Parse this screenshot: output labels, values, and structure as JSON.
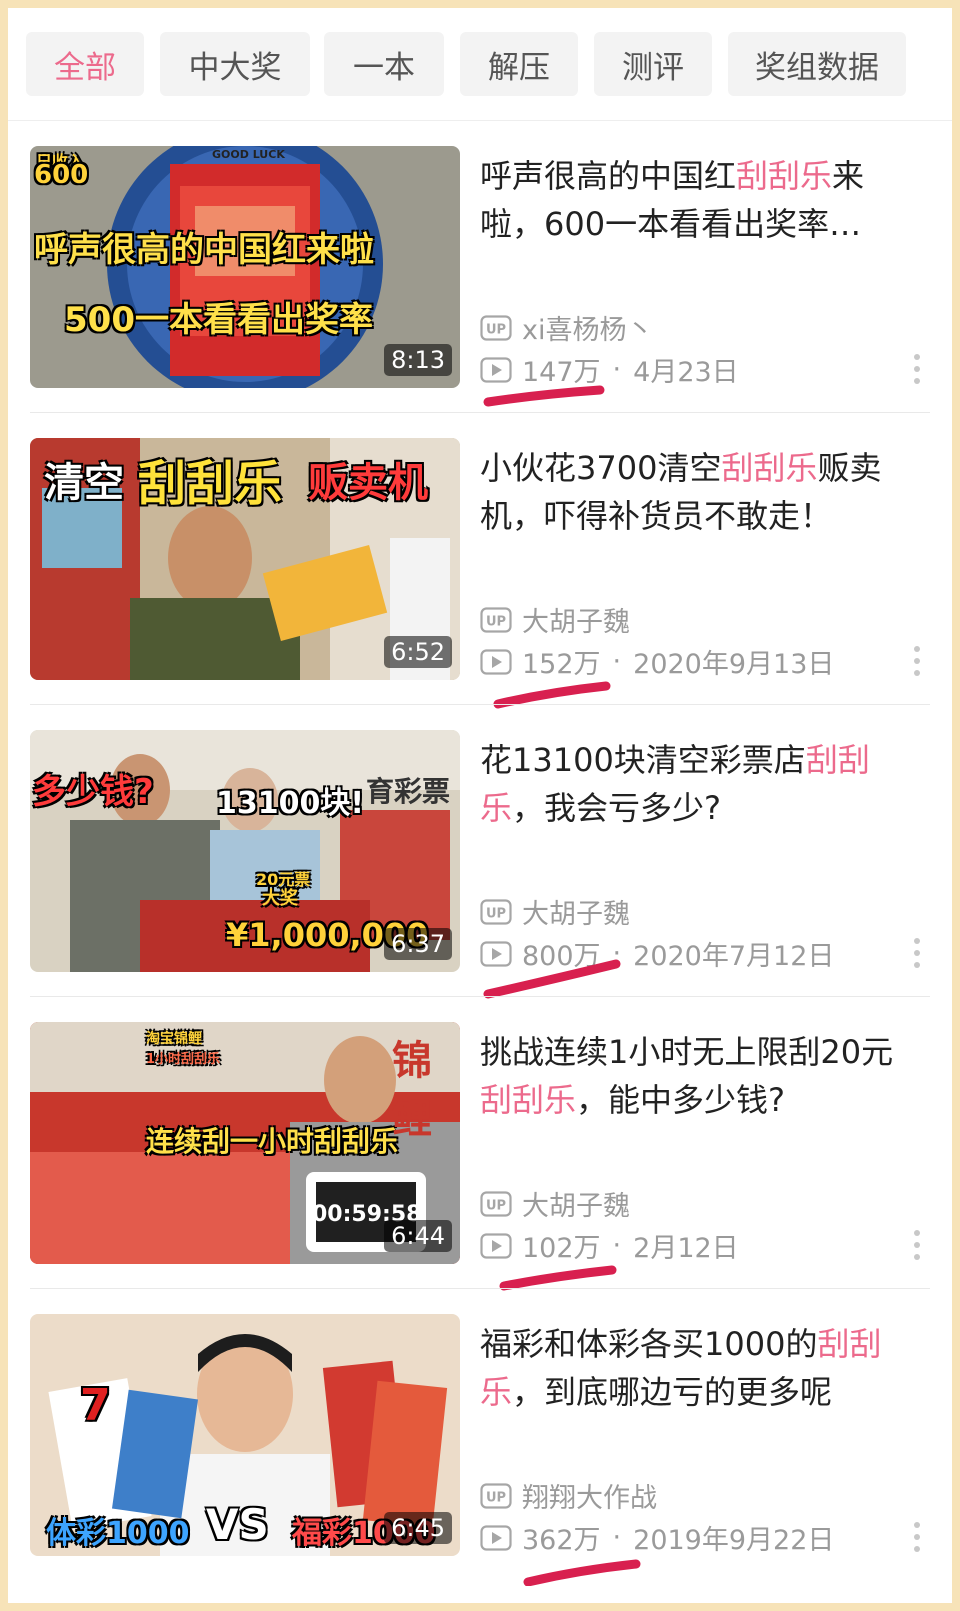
{
  "tabs": [
    {
      "label": "全部",
      "active": true
    },
    {
      "label": "中大奖"
    },
    {
      "label": "一本"
    },
    {
      "label": "解压"
    },
    {
      "label": "测评"
    },
    {
      "label": "奖组数据"
    }
  ],
  "videos": [
    {
      "title_pre": "呼声很高的中国红",
      "title_hl": "刮刮乐",
      "title_post": "来啦，600一本看看出奖率…",
      "uploader": "xi喜杨杨丶",
      "views": "147万",
      "date": "4月23日",
      "duration": "8:13",
      "thumb_text": [
        "日收入",
        "600",
        "GOOD LUCK",
        "呼声很高的中国红来啦",
        "500一本看看出奖率"
      ]
    },
    {
      "title_pre": "小伙花3700清空",
      "title_hl": "刮刮乐",
      "title_post": "贩卖机，吓得补货员不敢走！",
      "uploader": "大胡子魏",
      "views": "152万",
      "date": "2020年9月13日",
      "duration": "6:52",
      "thumb_text": [
        "清空",
        "刮刮乐",
        "贩卖机"
      ]
    },
    {
      "title_pre": "花13100块清空彩票店",
      "title_hl": "刮刮乐",
      "title_post": "，我会亏多少?",
      "uploader": "大胡子魏",
      "views": "800万",
      "date": "2020年7月12日",
      "duration": "6:37",
      "thumb_text": [
        "多少钱?",
        "13100块!",
        "育彩票",
        "20元票",
        "大奖",
        "¥1,000,000"
      ]
    },
    {
      "title_pre": "挑战连续1小时无上限刮20元",
      "title_hl": "刮刮乐",
      "title_post": "，能中多少钱?",
      "uploader": "大胡子魏",
      "views": "102万",
      "date": "2月12日",
      "duration": "6:44",
      "thumb_text": [
        "淘宝锦鲤",
        "1小时刮刮乐",
        "连续刮一小时刮刮乐",
        "锦鲤",
        "00:59:58"
      ]
    },
    {
      "title_pre": "福彩和体彩各买1000的",
      "title_hl": "刮刮乐",
      "title_post": "，到底哪边亏的更多呢",
      "uploader": "翔翔大作战",
      "views": "362万",
      "date": "2019年9月22日",
      "duration": "6:45",
      "thumb_text": [
        "体彩1000",
        "VS",
        "福彩1000",
        "7"
      ]
    }
  ],
  "icons": {
    "up_badge": "up-badge-icon",
    "play_count": "play-count-icon",
    "more": "more-vertical-icon"
  },
  "colors": {
    "accent": "#ec6a8c",
    "underline": "#d8204f",
    "border": "#f7e3b8"
  }
}
